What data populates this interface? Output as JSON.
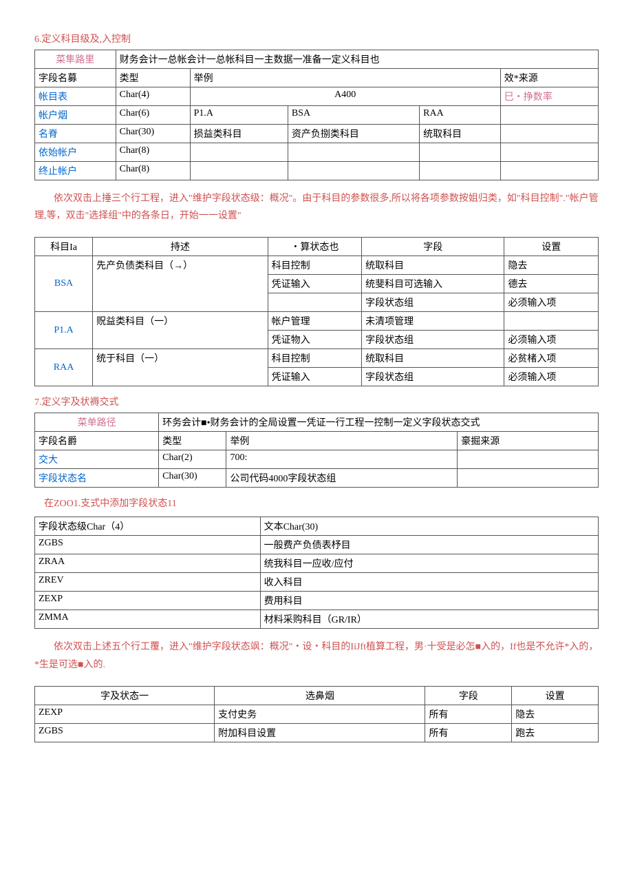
{
  "section6": {
    "heading": "6.定义科目级及,入控制",
    "table1": {
      "menu_path_label": "菜隼路里",
      "menu_path_value": "财务会计一总帐会计一总帐科目一主数据一准备一定义科目也",
      "h_field": "字段名募",
      "h_type": "类型",
      "h_example": "举例",
      "h_source": "效*来源",
      "rows": [
        {
          "field": "帐目表",
          "type": "Char(4)",
          "ex1": "A400",
          "ex2": "",
          "ex3": "",
          "source": "巳・挣数率",
          "colspan_ex": true
        },
        {
          "field": "帐户烟",
          "type": "Char(6)",
          "ex1": "P1.A",
          "ex2": "BSA",
          "ex3": "RAA",
          "source": ""
        },
        {
          "field": "名脊",
          "type": "Char(30)",
          "ex1": "损益类科目",
          "ex2": "资产负捌类科目",
          "ex3": "统取科目",
          "source": ""
        },
        {
          "field": "依始帐户",
          "type": "Char(8)",
          "ex1": "",
          "ex2": "",
          "ex3": "",
          "source": ""
        },
        {
          "field": "终止帐户",
          "type": "Char(8)",
          "ex1": "",
          "ex2": "",
          "ex3": "",
          "source": ""
        }
      ]
    },
    "para1": "依次双击上捶三个行工程，进入\"维护字段状态级：概况\"。由于科目的参数很多,所以将各项参数按姐归类，如\"科目控制\".\"帐户管理,等，双击\"选择组\"中的各条日，开始一一设置\"",
    "table2": {
      "h_code": "科目Ia",
      "h_desc": "持述",
      "h_status": "・算状态也",
      "h_field": "字段",
      "h_setting": "设置",
      "rows": [
        {
          "code": "BSA",
          "desc": "先产负债类科目（→）",
          "sub": [
            {
              "status": "科目控制",
              "field": "统取科目",
              "setting": "隐去"
            },
            {
              "status": "凭证输入",
              "field": "统斐科目可选输入",
              "setting": "德去"
            },
            {
              "status": "",
              "field": "字段状态组",
              "setting": "必须输入项"
            }
          ]
        },
        {
          "code": "P1.A",
          "desc": "贶益类科目（一）",
          "sub": [
            {
              "status": "帐户管理",
              "field": "未清项管理",
              "setting": ""
            },
            {
              "status": "凭证物入",
              "field": "字段状态组",
              "setting": "必须输入项"
            }
          ]
        },
        {
          "code": "RAA",
          "desc": "统于科目（一）",
          "sub": [
            {
              "status": "科目控制",
              "field": "统取科目",
              "setting": "必贫楮入项"
            },
            {
              "status": "凭证输入",
              "field": "字段状态组",
              "setting": "必须输入项"
            }
          ]
        }
      ]
    }
  },
  "section7": {
    "heading": "7.定义字及状褥交式",
    "table3": {
      "menu_path_label": "菜单路径",
      "menu_path_value": "环务会计■•财务会计的全局设置一凭证一行工程一控制一定义字段状态交式",
      "h_field": "字段名爵",
      "h_type": "类型",
      "h_example": "举例",
      "h_source": "豪掘来源",
      "rows": [
        {
          "field": "交大",
          "type": "Char(2)",
          "example": "700:",
          "source": ""
        },
        {
          "field": "字段状态名",
          "type": "Char(30)",
          "example": "公司代码4000字段状态组",
          "source": ""
        }
      ]
    },
    "note1": "在ZOO1.支式中添加字段状态11",
    "table4": {
      "h_code": "字段状态级Char（4）",
      "h_text": "文本Char(30)",
      "rows": [
        {
          "code": "ZGBS",
          "text": "一般费产负债表杼目"
        },
        {
          "code": "ZRAA",
          "text": "统我科目一应收/应付"
        },
        {
          "code": "ZREV",
          "text": "收入科目"
        },
        {
          "code": "ZEXP",
          "text": "费用科目"
        },
        {
          "code": "ZMMA",
          "text": "材料采购科目（GR/IR）"
        }
      ]
    },
    "para2": "依次双击上述五个行工覆，进入\"维护字段状态飒：概况\"・设・科目的IiJft植算工程，男·十受是必怎■入的，If也是不允许*入的，*生是可选■入的.",
    "table5": {
      "h_status": "字及状态一",
      "h_sel": "选鼻烟",
      "h_field": "字段",
      "h_setting": "设置",
      "rows": [
        {
          "status": "ZEXP",
          "sel": "支付史务",
          "field": "所有",
          "setting": "隐去"
        },
        {
          "status": "ZGBS",
          "sel": "附加科目设置",
          "field": "所有",
          "setting": "跑去"
        }
      ]
    }
  }
}
